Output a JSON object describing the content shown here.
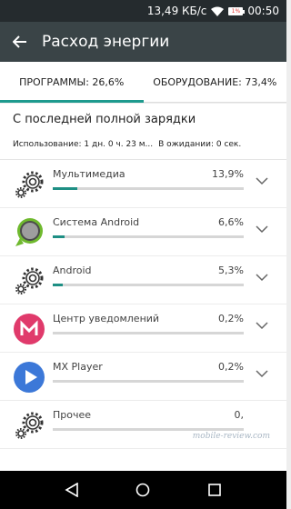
{
  "status_bar": {
    "speed": "13,49 КБ/с",
    "battery": "1%",
    "time": "00:50"
  },
  "app_bar": {
    "title": "Расход энергии"
  },
  "tabs": [
    {
      "label": "ПРОГРАММЫ: 26,6%",
      "active": true
    },
    {
      "label": "ОБОРУДОВАНИЕ: 73,4%",
      "active": false
    }
  ],
  "summary": {
    "title": "С последней полной зарядки",
    "usage": "Использование: 1 дн. 0 ч. 23 м...",
    "standby": "В ожидании: 0 сек."
  },
  "items": [
    {
      "name": "Мультимедиа",
      "percent": "13,9%",
      "fill": 0.13,
      "icon": "gear-icon"
    },
    {
      "name": "Система Android",
      "percent": "6,6%",
      "fill": 0.06,
      "icon": "android-system-icon"
    },
    {
      "name": "Android",
      "percent": "5,3%",
      "fill": 0.05,
      "icon": "gear-icon"
    },
    {
      "name": "Центр уведомлений",
      "percent": "0,2%",
      "fill": 0.0,
      "icon": "notification-center-icon"
    },
    {
      "name": "MX Player",
      "percent": "0,2%",
      "fill": 0.0,
      "icon": "mx-player-icon"
    },
    {
      "name": "Прочее",
      "percent": "0,",
      "fill": 0.0,
      "icon": "gear-icon"
    }
  ],
  "watermark": "mobile-review.com",
  "colors": {
    "accent": "#1e9a8e",
    "app_bar": "#3a4447",
    "status_bar": "#252b2e"
  }
}
